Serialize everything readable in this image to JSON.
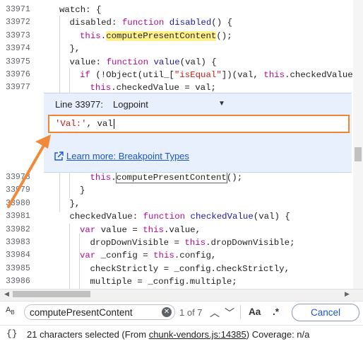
{
  "editor": {
    "lines_top": [
      {
        "num": "33971",
        "indent": 0,
        "tokens": [
          {
            "t": "watch: {",
            "c": "plain"
          }
        ]
      },
      {
        "num": "33972",
        "indent": 1,
        "tokens": [
          {
            "t": "disabled: ",
            "c": "plain"
          },
          {
            "t": "function ",
            "c": "kw"
          },
          {
            "t": "disabled",
            "c": "fn"
          },
          {
            "t": "() {",
            "c": "plain"
          }
        ]
      },
      {
        "num": "33973",
        "indent": 2,
        "tokens": [
          {
            "t": "this",
            "c": "kw"
          },
          {
            "t": ".",
            "c": "plain"
          },
          {
            "t": "computePresentContent",
            "c": "plain",
            "hl": "yellow"
          },
          {
            "t": "();",
            "c": "plain"
          }
        ]
      },
      {
        "num": "33974",
        "indent": 1,
        "tokens": [
          {
            "t": "},",
            "c": "plain"
          }
        ]
      },
      {
        "num": "33975",
        "indent": 1,
        "tokens": [
          {
            "t": "value: ",
            "c": "plain"
          },
          {
            "t": "function ",
            "c": "kw"
          },
          {
            "t": "value",
            "c": "fn"
          },
          {
            "t": "(val) {",
            "c": "plain"
          }
        ]
      },
      {
        "num": "33976",
        "indent": 2,
        "tokens": [
          {
            "t": "if ",
            "c": "kw"
          },
          {
            "t": "(!Object(util_[",
            "c": "plain"
          },
          {
            "t": "\"isEqual\"",
            "c": "str"
          },
          {
            "t": "])(val, ",
            "c": "plain"
          },
          {
            "t": "this",
            "c": "kw"
          },
          {
            "t": ".checkedValue))",
            "c": "plain"
          }
        ]
      },
      {
        "num": "33977",
        "indent": 3,
        "tokens": [
          {
            "t": "this",
            "c": "kw"
          },
          {
            "t": ".checkedValue = val;",
            "c": "plain"
          }
        ]
      }
    ],
    "lines_bottom": [
      {
        "num": "33978",
        "indent": 3,
        "tokens": [
          {
            "t": "this",
            "c": "kw"
          },
          {
            "t": ".",
            "c": "plain"
          },
          {
            "t": "computePresentContent",
            "c": "plain",
            "hl": "box"
          },
          {
            "t": "();",
            "c": "plain"
          }
        ]
      },
      {
        "num": "33979",
        "indent": 2,
        "tokens": [
          {
            "t": "}",
            "c": "plain"
          }
        ]
      },
      {
        "num": "33980",
        "indent": 1,
        "tokens": [
          {
            "t": "},",
            "c": "plain"
          }
        ]
      },
      {
        "num": "33981",
        "indent": 1,
        "tokens": [
          {
            "t": "checkedValue: ",
            "c": "plain"
          },
          {
            "t": "function ",
            "c": "kw"
          },
          {
            "t": "checkedValue",
            "c": "fn"
          },
          {
            "t": "(val) {",
            "c": "plain"
          }
        ]
      },
      {
        "num": "33982",
        "indent": 2,
        "tokens": [
          {
            "t": "var ",
            "c": "kw"
          },
          {
            "t": "value = ",
            "c": "plain"
          },
          {
            "t": "this",
            "c": "kw"
          },
          {
            "t": ".value,",
            "c": "plain"
          }
        ]
      },
      {
        "num": "33983",
        "indent": 3,
        "tokens": [
          {
            "t": "dropDownVisible = ",
            "c": "plain"
          },
          {
            "t": "this",
            "c": "kw"
          },
          {
            "t": ".dropDownVisible;",
            "c": "plain"
          }
        ]
      },
      {
        "num": "33984",
        "indent": 2,
        "tokens": [
          {
            "t": "var ",
            "c": "kw"
          },
          {
            "t": "_config = ",
            "c": "plain"
          },
          {
            "t": "this",
            "c": "kw"
          },
          {
            "t": ".config,",
            "c": "plain"
          }
        ]
      },
      {
        "num": "33985",
        "indent": 3,
        "tokens": [
          {
            "t": "checkStrictly = _config.checkStrictly,",
            "c": "plain"
          }
        ]
      },
      {
        "num": "33986",
        "indent": 3,
        "tokens": [
          {
            "t": "multiple = _config.multiple;",
            "c": "plain"
          }
        ]
      }
    ]
  },
  "logpoint": {
    "line_label": "Line 33977:",
    "type_label": "Logpoint",
    "expression_str": "'Val:'",
    "expression_rest": ", val",
    "learn_more": "Learn more: Breakpoint Types"
  },
  "find": {
    "query": "computePresentContent",
    "count": "1 of 7",
    "case_label": "Aa",
    "regex_label": ".*",
    "cancel_label": "Cancel"
  },
  "status": {
    "braces": "{}",
    "selected": "21 characters selected",
    "from_prefix": "(From ",
    "source": "chunk-vendors.js:14385",
    "from_suffix": ")",
    "coverage": "Coverage: n/a"
  },
  "colors": {
    "keyword": "#aa0d91",
    "function_name": "#1a1aa6",
    "string": "#c41a16",
    "link": "#1a56c4",
    "logpoint_bg": "#e8f0fe",
    "input_border": "#ef8432",
    "arrow": "#f08a3a",
    "yellow_highlight": "#fff08a"
  }
}
